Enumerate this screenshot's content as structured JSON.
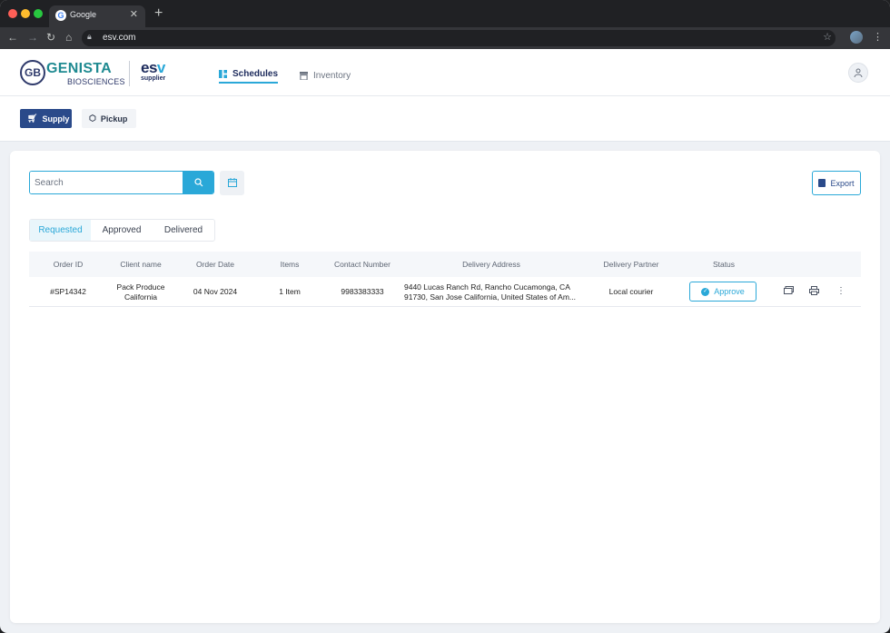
{
  "browser": {
    "tab_title": "Google",
    "url": "esv.com"
  },
  "brand": {
    "logo_initials": "GB",
    "logo_name": "GENISTA",
    "logo_sub": "BIOSCIENCES",
    "esv_prefix": "es",
    "esv_suffix": "v",
    "esv_sub": "supplier"
  },
  "nav": {
    "schedules": "Schedules",
    "inventory": "Inventory"
  },
  "segment": {
    "supply": "Supply",
    "pickup": "Pickup"
  },
  "search": {
    "placeholder": "Search"
  },
  "export_label": "Export",
  "tabs": {
    "requested": "Requested",
    "approved": "Approved",
    "delivered": "Delivered"
  },
  "table": {
    "headers": [
      "Order ID",
      "Client name",
      "Order Date",
      "Items",
      "Contact Number",
      "Delivery Address",
      "Delivery Partner",
      "Status"
    ],
    "rows": [
      {
        "order_id": "#SP14342",
        "client_line1": "Pack Produce",
        "client_line2": "California",
        "order_date": "04 Nov 2024",
        "items": "1 Item",
        "contact": "9983383333",
        "address_line1": "9440 Lucas Ranch Rd, Rancho Cucamonga, CA",
        "address_line2": "91730, San Jose California, United States of Am...",
        "partner": "Local courier",
        "status_action": "Approve"
      }
    ]
  },
  "colors": {
    "accent": "#2aa8d8",
    "primary": "#2a4a8a",
    "brand_teal": "#1f8a91"
  }
}
